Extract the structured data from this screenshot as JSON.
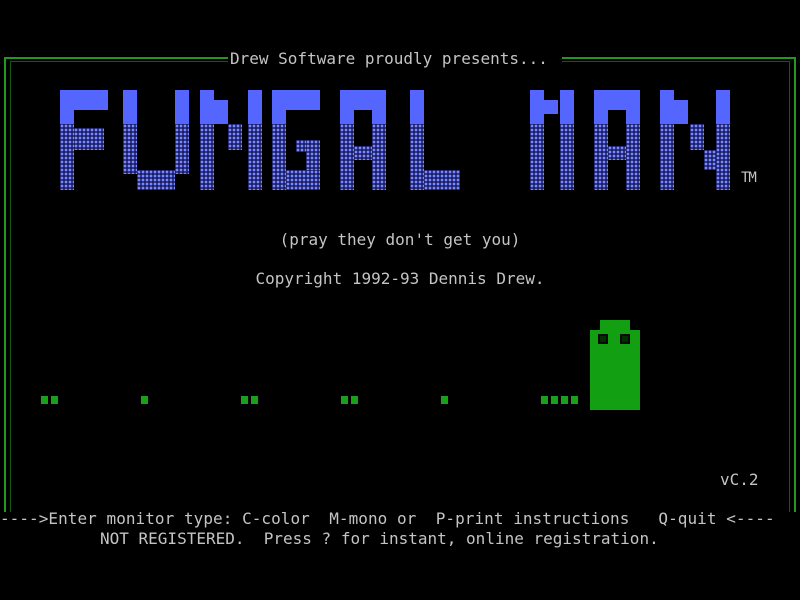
{
  "header": {
    "presents": "Drew Software proudly presents..."
  },
  "title": {
    "logo_text": "FUNGAL MAN",
    "trademark": "TM"
  },
  "tagline": "(pray they don't get you)",
  "copyright": "Copyright 1992-93 Dennis Drew.",
  "version": "vC.2",
  "prompt": {
    "line": "---->Enter monitor type: C-color  M-mono or  P-print instructions   Q-quit <----",
    "registration": "NOT REGISTERED.  Press ? for instant, online registration."
  },
  "colors": {
    "frame": "#1f9a1f",
    "logo_top": "#5566ff",
    "logo_shade": "#7a88ff",
    "pellet": "#1aa11a",
    "character": "#12a012",
    "text": "#c4c4c4"
  },
  "icons": [
    "fungal-man-character-icon",
    "pellet-icon"
  ]
}
